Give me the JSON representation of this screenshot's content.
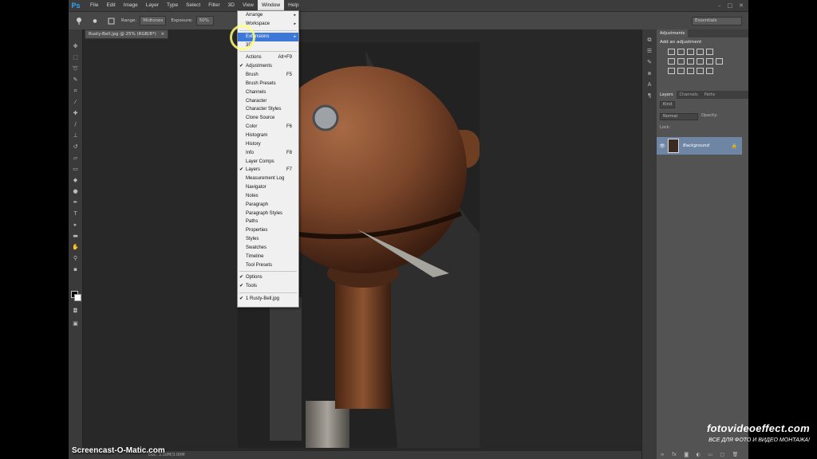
{
  "app": {
    "logo": "Ps"
  },
  "menubar": [
    "File",
    "Edit",
    "Image",
    "Layer",
    "Type",
    "Select",
    "Filter",
    "3D",
    "View",
    "Window",
    "Help"
  ],
  "menubar_active": "Window",
  "window_controls": [
    "–",
    "□",
    "✕"
  ],
  "options": {
    "range_label": "Range:",
    "range_value": "Midtones",
    "exposure_label": "Exposure:",
    "exposure_value": "50%",
    "workspace": "Essentials"
  },
  "document_tab": "Rusty-Bell.jpg @ 25% (RGB/8*)",
  "status": "Doc: 3.00M/3.00M",
  "window_menu": {
    "group1": [
      {
        "label": "Arrange",
        "submenu": true
      },
      {
        "label": "Workspace",
        "submenu": true
      }
    ],
    "group2": [
      {
        "label": "Extensions",
        "submenu": true,
        "highlight": true
      },
      {
        "label": "3D"
      }
    ],
    "group3": [
      {
        "label": "Actions",
        "shortcut": "Alt+F9"
      },
      {
        "label": "Adjustments",
        "check": true
      },
      {
        "label": "Brush",
        "shortcut": "F5"
      },
      {
        "label": "Brush Presets"
      },
      {
        "label": "Channels"
      },
      {
        "label": "Character"
      },
      {
        "label": "Character Styles"
      },
      {
        "label": "Clone Source"
      },
      {
        "label": "Color",
        "shortcut": "F6"
      },
      {
        "label": "Histogram"
      },
      {
        "label": "History"
      },
      {
        "label": "Info",
        "shortcut": "F8"
      },
      {
        "label": "Layer Comps"
      },
      {
        "label": "Layers",
        "shortcut": "F7",
        "check": true
      },
      {
        "label": "Measurement Log"
      },
      {
        "label": "Navigator"
      },
      {
        "label": "Notes"
      },
      {
        "label": "Paragraph"
      },
      {
        "label": "Paragraph Styles"
      },
      {
        "label": "Paths"
      },
      {
        "label": "Properties"
      },
      {
        "label": "Styles"
      },
      {
        "label": "Swatches"
      },
      {
        "label": "Timeline"
      },
      {
        "label": "Tool Presets"
      }
    ],
    "group4": [
      {
        "label": "Options",
        "check": true
      },
      {
        "label": "Tools",
        "check": true
      }
    ],
    "group5": [
      {
        "label": "1 Rusty-Bell.jpg",
        "check": true
      }
    ]
  },
  "adjustments_panel": {
    "tab": "Adjustments",
    "title": "Add an adjustment"
  },
  "layers_panel": {
    "tabs": [
      "Layers",
      "Channels",
      "Paths"
    ],
    "kind": "Kind",
    "blend": "Normal",
    "opacity_label": "Opacity:",
    "lock_label": "Lock:",
    "layer_name": "Background"
  },
  "watermarks": {
    "left": "Screencast-O-Matic.com",
    "right_title": "fotovideoeffect.com",
    "right_sub": "ВСЕ ДЛЯ ФОТО И ВИДЕО МОНТАЖА!"
  }
}
